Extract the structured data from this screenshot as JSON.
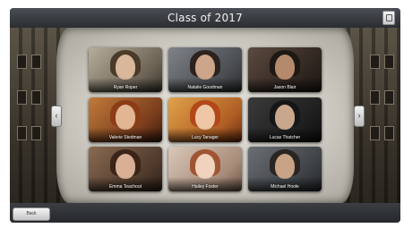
{
  "window": {
    "title": "Class of 2017",
    "corner_icon": "square-icon"
  },
  "navigation": {
    "prev_icon": "chevron-left-icon",
    "next_icon": "chevron-right-icon",
    "prev_glyph": "‹",
    "next_glyph": "›"
  },
  "students": [
    {
      "name": "Ryan Roper"
    },
    {
      "name": "Natalie Goodman"
    },
    {
      "name": "Jason Blair"
    },
    {
      "name": "Valerie Stedman"
    },
    {
      "name": "Lucy Tanager"
    },
    {
      "name": "Lucas Thatcher"
    },
    {
      "name": "Emma Teachout"
    },
    {
      "name": "Hailey Foster"
    },
    {
      "name": "Michael Hoole"
    }
  ],
  "footer": {
    "back_label": "Back"
  }
}
